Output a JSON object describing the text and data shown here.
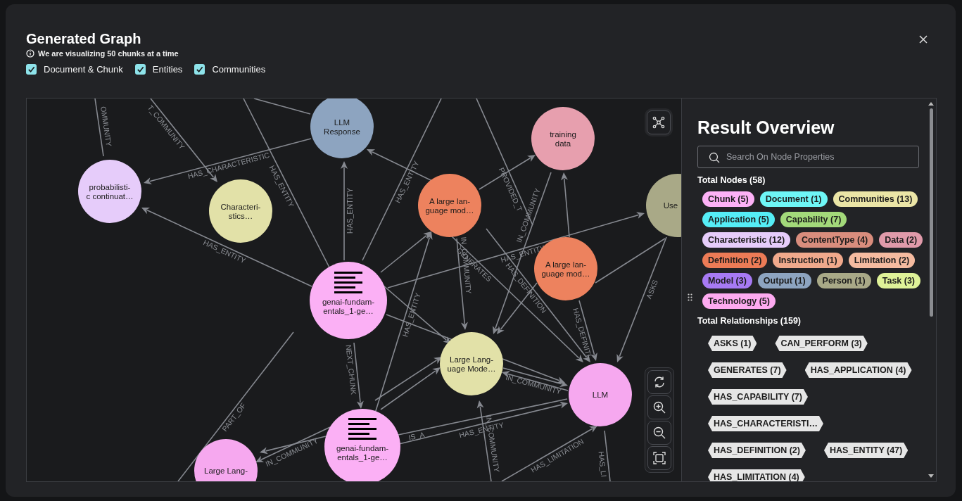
{
  "dialog": {
    "title": "Generated Graph",
    "note": "We are visualizing 50 chunks at a time",
    "filters": [
      {
        "label": "Document & Chunk",
        "checked": true
      },
      {
        "label": "Entities",
        "checked": true
      },
      {
        "label": "Communities",
        "checked": true
      }
    ]
  },
  "graph": {
    "nodes": [
      {
        "kind": "entity",
        "lines": [
          "LLM",
          "Response"
        ],
        "color": "#8da4c0"
      },
      {
        "kind": "entity",
        "lines": [
          "probabilisti-",
          "c continuat…"
        ],
        "color": "#e6ccfa"
      },
      {
        "kind": "entity",
        "lines": [
          "Characteri-",
          "stics…"
        ],
        "color": "#e2e1a8"
      },
      {
        "kind": "entity",
        "lines": [
          "training",
          "data"
        ],
        "color": "#e79fae"
      },
      {
        "kind": "entity",
        "lines": [
          "A large lan-",
          "guage mod…"
        ],
        "color": "#ed825e"
      },
      {
        "kind": "entity",
        "lines": [
          "Use"
        ],
        "color": "#a9a987"
      },
      {
        "kind": "entity",
        "lines": [
          "A large lan-",
          "guage mod…"
        ],
        "color": "#ed825e"
      },
      {
        "kind": "chunk",
        "lines": [
          "genai-fundam-",
          "entals_1-ge…"
        ],
        "color": "#fbb0f5"
      },
      {
        "kind": "entity",
        "lines": [
          "Large Lang-",
          "uage Mode…"
        ],
        "color": "#e2e1a8"
      },
      {
        "kind": "entity",
        "lines": [
          "LLM"
        ],
        "color": "#f6a8ef"
      },
      {
        "kind": "chunk",
        "lines": [
          "genai-fundam-",
          "entals_1-ge…"
        ],
        "color": "#fbb0f5"
      },
      {
        "kind": "entity",
        "lines": [
          "Large Lang-"
        ],
        "color": "#f6a8ef"
      }
    ],
    "edges": [
      {
        "label": "OMMUNITY",
        "arrow": false
      },
      {
        "label": "T_COMMUNITY",
        "arrow": true
      },
      {
        "label": "HAS_CHARACTERISTIC",
        "arrow": true
      },
      {
        "label": "HAS_ENTITY",
        "arrow": false
      },
      {
        "label": "HAS_ENTITY",
        "arrow": true
      },
      {
        "label": "HAS_ENTITY",
        "arrow": true
      },
      {
        "label": "HAS_ENTITY",
        "arrow": false
      },
      {
        "label": "GENERATES",
        "arrow": true
      },
      {
        "label": "IN_COMMUNITY",
        "arrow": true
      },
      {
        "label": "HAS_ENTITY",
        "arrow": true
      },
      {
        "label": "IN_COMMUNITY",
        "arrow": true
      },
      {
        "label": "PROVIDED_T"
      },
      {
        "label": "HAS_DEFINITION",
        "arrow": true
      },
      {
        "label": "HAS_DEFINITI",
        "arrow": true
      },
      {
        "label": "ASKS",
        "arrow": true
      },
      {
        "label": "IN_COMMUNITY",
        "arrow": true
      },
      {
        "label": "HAS_ENTITY",
        "arrow": true
      },
      {
        "label": "NEXT_CHUNK",
        "arrow": true
      },
      {
        "label": "HAS_ENTITY",
        "arrow": true
      },
      {
        "label": "IS_A",
        "arrow": false
      },
      {
        "label": "IN_COMMUNITY",
        "arrow": true
      },
      {
        "label": "PART_OF",
        "arrow": false
      },
      {
        "label": "IN_COMMUNITY",
        "arrow": true
      },
      {
        "label": "HAS_LIMITATION",
        "arrow": true
      },
      {
        "label": "HAS_LI",
        "arrow": false
      },
      {
        "arrow": true
      },
      {
        "arrow": true
      },
      {
        "arrow": true
      },
      {
        "arrow": true
      },
      {
        "arrow": true
      },
      {
        "arrow": true
      },
      {
        "arrow": true
      },
      {
        "arrow": true
      },
      {
        "arrow": false
      },
      {
        "arrow": true
      },
      {
        "arrow": false
      },
      {
        "arrow": true
      },
      {
        "arrow": true
      }
    ]
  },
  "overview": {
    "title": "Result Overview",
    "search": {
      "placeholder": "Search On Node Properties"
    },
    "nodes_heading": "Total Nodes (58)",
    "node_labels": [
      {
        "text": "Chunk (5)",
        "color": "#fdb1f6"
      },
      {
        "text": "Document (1)",
        "color": "#6ef6f6"
      },
      {
        "text": "Communities (13)",
        "color": "#ebe5a6"
      },
      {
        "text": "Application (5)",
        "color": "#55edf6"
      },
      {
        "text": "Capability (7)",
        "color": "#a3d97a"
      },
      {
        "text": "Characteristic (12)",
        "color": "#e6ccfa"
      },
      {
        "text": "ContentType (4)",
        "color": "#d98d7d"
      },
      {
        "text": "Data (2)",
        "color": "#e09aaa"
      },
      {
        "text": "Definition (2)",
        "color": "#ec7b56"
      },
      {
        "text": "Instruction (1)",
        "color": "#f0a98c"
      },
      {
        "text": "Limitation (2)",
        "color": "#f5bba0"
      },
      {
        "text": "Model (3)",
        "color": "#a77af4"
      },
      {
        "text": "Output (1)",
        "color": "#8da4c0"
      },
      {
        "text": "Person (1)",
        "color": "#a9a987"
      },
      {
        "text": "Task (3)",
        "color": "#dff298"
      },
      {
        "text": "Technology (5)",
        "color": "#fdaaf0"
      }
    ],
    "relationships_heading": "Total Relationships (159)",
    "relationships": [
      "ASKS (1)",
      "CAN_PERFORM (3)",
      "GENERATES (7)",
      "HAS_APPLICATION (4)",
      "HAS_CAPABILITY (7)",
      "HAS_CHARACTERISTI…",
      "HAS_DEFINITION (2)",
      "HAS_ENTITY (47)",
      "HAS_LIMITATION (4)"
    ]
  }
}
